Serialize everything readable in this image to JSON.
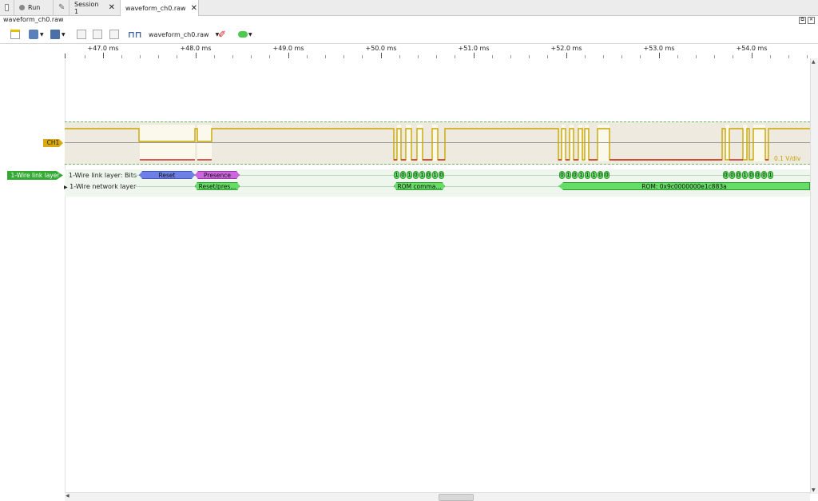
{
  "tabs": {
    "run_label": "Run",
    "session_label": "Session 1",
    "file_label": "waveform_ch0.raw"
  },
  "document_title": "waveform_ch0.raw",
  "toolbar": {
    "file_selector": "waveform_ch0.raw"
  },
  "ruler": {
    "ticks": [
      "+47.0 ms",
      "+48.0 ms",
      "+49.0 ms",
      "+50.0 ms",
      "+51.0 ms",
      "+52.0 ms",
      "+53.0 ms",
      "+54.0 ms"
    ]
  },
  "channel": {
    "name": "CH1",
    "scale": "0.1 V/div",
    "colors": {
      "trace": "#c8a800",
      "low": "#cc2222",
      "badge": "#d8aa10"
    }
  },
  "decoder": {
    "name": "1-Wire link layer",
    "link_row_label": "1-Wire link layer: Bits",
    "network_row_label": "1-Wire network layer",
    "reset": "Reset",
    "presence": "Presence",
    "reset_presence": "Reset/pres...",
    "rom_command": "ROM comma...",
    "rom_value": "ROM: 0x9c0000000e1c883a",
    "bits_group1": [
      "1",
      "0",
      "1",
      "0",
      "1",
      "0",
      "1",
      "0"
    ],
    "bits_group2": [
      "0",
      "1",
      "0",
      "1",
      "1",
      "1",
      "0",
      "0"
    ],
    "bits_group3": [
      "0",
      "0",
      "0",
      "1",
      "0",
      "0",
      "0",
      "1"
    ],
    "colors": {
      "badge": "#33aa33",
      "reset": "#6e7fe6",
      "presence": "#cc66dd",
      "network": "#66dd66"
    }
  }
}
